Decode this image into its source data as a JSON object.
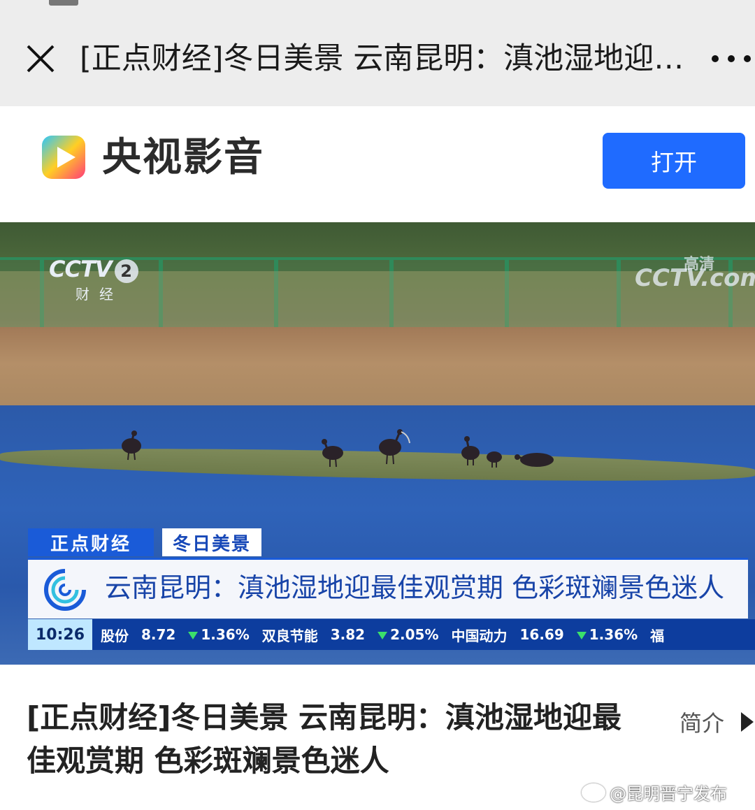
{
  "nav": {
    "title": "[正点财经]冬日美景 云南昆明：滇池湿地迎最佳观赏期 色彩斑斓景色迷人",
    "close_icon": "close-icon",
    "more_icon": "more-icon"
  },
  "banner": {
    "app_name": "央视影音",
    "open_label": "打开",
    "accent": "#1f6bff"
  },
  "video": {
    "channel_logo": "CCTV",
    "channel_number": "2",
    "channel_sub": "财经",
    "hd_logo": "CCTV.com",
    "hd_tag": "高清",
    "tab_program": "正点财经",
    "tab_segment": "冬日美景",
    "headline": "云南昆明：滇池湿地迎最佳观赏期 色彩斑斓景色迷人",
    "ticker": {
      "time": "10:26",
      "items": [
        {
          "name": "股份",
          "price": "8.72",
          "change": "1.36%"
        },
        {
          "name": "双良节能",
          "price": "3.82",
          "change": "2.05%"
        },
        {
          "name": "中国动力",
          "price": "16.69",
          "change": "1.36%"
        },
        {
          "name": "福",
          "price": "",
          "change": ""
        }
      ]
    }
  },
  "content": {
    "title": "[正点财经]冬日美景 云南昆明：滇池湿地迎最佳观赏期 色彩斑斓景色迷人",
    "intro_label": "简介",
    "watermark": "@昆明晋宁发布"
  }
}
